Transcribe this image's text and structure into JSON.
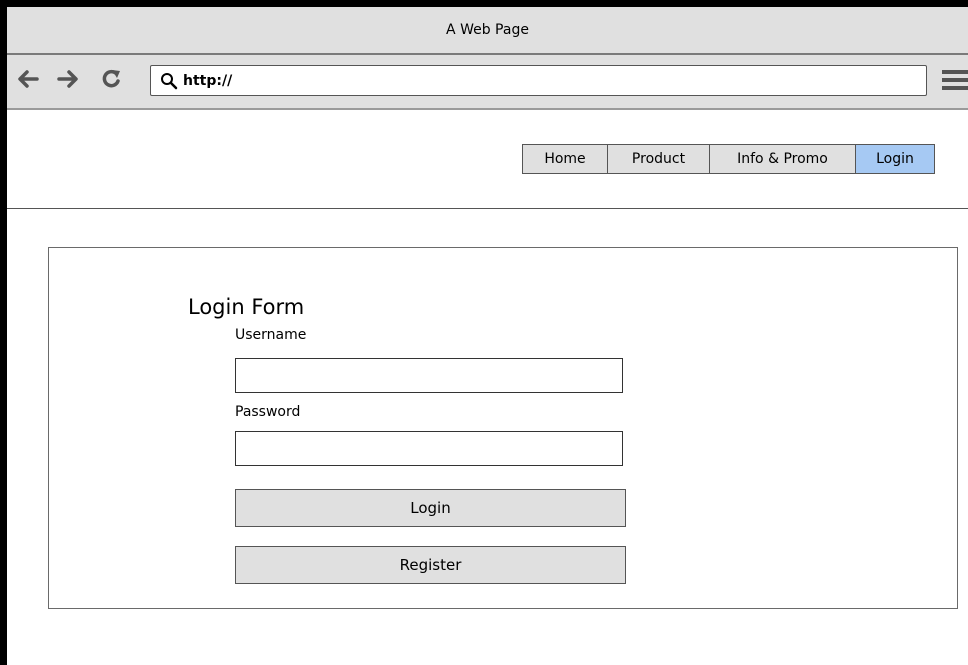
{
  "window": {
    "title": "A Web Page"
  },
  "toolbar": {
    "url": "http://",
    "icons": [
      "back-arrow-icon",
      "forward-arrow-icon",
      "refresh-icon",
      "search-icon",
      "menu-icon"
    ]
  },
  "nav": {
    "tabs": [
      {
        "label": "Home",
        "active": false
      },
      {
        "label": "Product",
        "active": false
      },
      {
        "label": "Info & Promo",
        "active": false
      },
      {
        "label": "Login",
        "active": true
      }
    ],
    "active_color": "#a6c9f3"
  },
  "form": {
    "title": "Login Form",
    "username_label": "Username",
    "username_value": "",
    "password_label": "Password",
    "password_value": "",
    "login_button": "Login",
    "register_button": "Register"
  }
}
